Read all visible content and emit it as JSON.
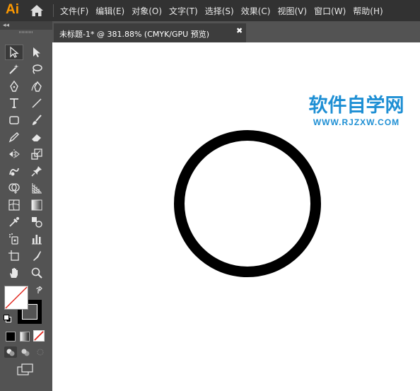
{
  "app": {
    "logo": "Ai",
    "home_icon": "home-icon"
  },
  "menu": {
    "items": [
      "文件(F)",
      "编辑(E)",
      "对象(O)",
      "文字(T)",
      "选择(S)",
      "效果(C)",
      "视图(V)",
      "窗口(W)",
      "帮助(H)"
    ]
  },
  "toolbar": {
    "collapse_label": "◂◂",
    "tools": [
      "selection-tool",
      "direct-selection-tool",
      "magic-wand-tool",
      "lasso-tool",
      "pen-tool",
      "curvature-tool",
      "type-tool",
      "line-segment-tool",
      "rectangle-tool",
      "paintbrush-tool",
      "pencil-tool",
      "eraser-tool",
      "reflect-tool",
      "scale-tool",
      "warp-tool",
      "puppet-warp-tool",
      "shape-builder-tool",
      "perspective-grid-tool",
      "mesh-tool",
      "gradient-tool",
      "eyedropper-tool",
      "blend-tool",
      "symbol-sprayer-tool",
      "column-graph-tool",
      "artboard-tool",
      "slice-tool",
      "hand-tool",
      "zoom-tool"
    ],
    "fill_stroke": {
      "fill": "none",
      "stroke": "#000000"
    },
    "color_modes": [
      "color",
      "gradient",
      "none"
    ],
    "draw_modes": [
      "draw-normal",
      "draw-behind",
      "draw-inside"
    ],
    "screen_mode_icon": "screen-mode-icon"
  },
  "document": {
    "tab_label": "未标题-1* @ 381.88% (CMYK/GPU 预览)",
    "close_icon": "close-icon",
    "zoom": "381.88%",
    "color_mode": "CMYK/GPU 预览"
  },
  "watermark": {
    "title": "软件自学网",
    "url": "WWW.RJZXW.COM",
    "color": "#1e8fd4"
  },
  "artwork": {
    "shape": "circle",
    "stroke": "#000000",
    "fill": "#ffffff"
  }
}
